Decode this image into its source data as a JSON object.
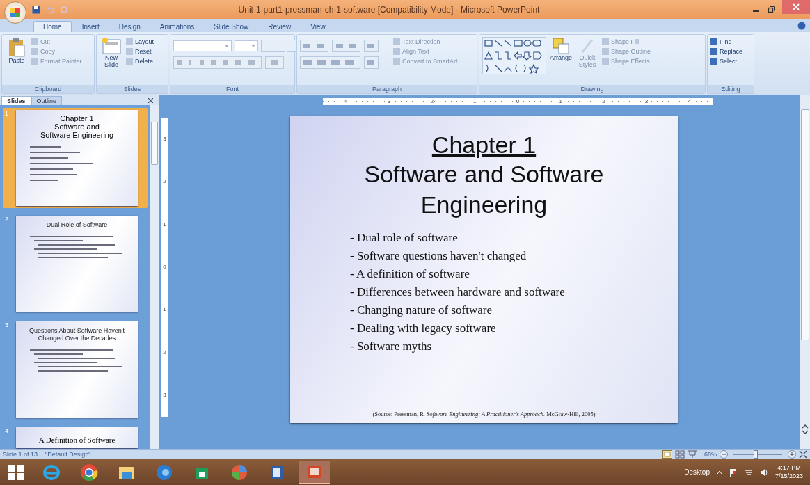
{
  "window": {
    "title": "Unit-1-part1-pressman-ch-1-software [Compatibility Mode] - Microsoft PowerPoint"
  },
  "tabs": [
    {
      "label": "Home",
      "selected": true
    },
    {
      "label": "Insert",
      "selected": false
    },
    {
      "label": "Design",
      "selected": false
    },
    {
      "label": "Animations",
      "selected": false
    },
    {
      "label": "Slide Show",
      "selected": false
    },
    {
      "label": "Review",
      "selected": false
    },
    {
      "label": "View",
      "selected": false
    }
  ],
  "ribbon": {
    "groups": [
      {
        "label": "Clipboard",
        "kind": "clipboard",
        "items": [
          {
            "label": "Paste",
            "disabled": false
          },
          {
            "label": "Cut",
            "disabled": true
          },
          {
            "label": "Copy",
            "disabled": true
          },
          {
            "label": "Format Painter",
            "disabled": true
          }
        ]
      },
      {
        "label": "Slides",
        "kind": "slides",
        "items": [
          {
            "label": "New Slide",
            "disabled": false
          },
          {
            "label": "Layout",
            "disabled": false
          },
          {
            "label": "Reset",
            "disabled": false
          },
          {
            "label": "Delete",
            "disabled": false
          }
        ]
      },
      {
        "label": "Font",
        "kind": "font"
      },
      {
        "label": "Paragraph",
        "kind": "paragraph",
        "items": [
          {
            "label": "Text Direction",
            "disabled": true
          },
          {
            "label": "Align Text",
            "disabled": true
          },
          {
            "label": "Convert to SmartArt",
            "disabled": true
          }
        ]
      },
      {
        "label": "Drawing",
        "kind": "drawing",
        "items": [
          {
            "label": "Arrange",
            "disabled": false
          },
          {
            "label": "Quick Styles",
            "disabled": true
          },
          {
            "label": "Shape Fill",
            "disabled": true
          },
          {
            "label": "Shape Outline",
            "disabled": true
          },
          {
            "label": "Shape Effects",
            "disabled": true
          }
        ]
      },
      {
        "label": "Editing",
        "kind": "editing",
        "items": [
          {
            "label": "Find",
            "disabled": false
          },
          {
            "label": "Replace",
            "disabled": false
          },
          {
            "label": "Select",
            "disabled": false
          }
        ]
      }
    ]
  },
  "pane_tabs": [
    {
      "label": "Slides",
      "selected": true
    },
    {
      "label": "Outline",
      "selected": false
    }
  ],
  "thumbnails": [
    {
      "number": "1",
      "kind": "title",
      "selected": true,
      "heading": "Chapter 1",
      "title": "Software and Software Engineering"
    },
    {
      "number": "2",
      "kind": "content",
      "selected": false,
      "title": "Dual Role of Software"
    },
    {
      "number": "3",
      "kind": "content",
      "selected": false,
      "title": "Questions About Software Haven't Changed Over the Decades"
    },
    {
      "number": "4",
      "kind": "partial",
      "selected": false,
      "title": "A Definition of Software"
    }
  ],
  "ruler": {
    "horizontal": [
      "4",
      "3",
      "2",
      "1",
      "0",
      "1",
      "2",
      "3",
      "4"
    ],
    "vertical": [
      "3",
      "2",
      "1",
      "0",
      "1",
      "2",
      "3"
    ]
  },
  "slide": {
    "heading": "Chapter 1",
    "title": "Software and Software Engineering",
    "bullets": [
      "- Dual role of software",
      "- Software questions haven't changed",
      "- A definition of software",
      "- Differences between hardware and software",
      "- Changing nature of software",
      "- Dealing with legacy software",
      "- Software myths"
    ],
    "source": "(Source: Pressman, R. *Software Engineering: A Practitioner's Approach.* McGraw-Hill, 2005)"
  },
  "status_bar": {
    "slide": "Slide 1 of 13",
    "theme": "\"Default Design\"",
    "zoom": "60%",
    "level": 0.45
  },
  "taskbar": {
    "apps": [
      {
        "kind": "ie",
        "selected": false
      },
      {
        "kind": "chrome",
        "selected": false
      },
      {
        "kind": "folder",
        "selected": false
      },
      {
        "kind": "edge",
        "selected": false
      },
      {
        "kind": "store",
        "selected": false
      },
      {
        "kind": "picasa",
        "selected": false
      },
      {
        "kind": "word",
        "selected": false
      },
      {
        "kind": "powerpoint",
        "selected": true
      }
    ],
    "desktop": "Desktop",
    "time": "4:17 PM",
    "date": "7/15/2023"
  }
}
